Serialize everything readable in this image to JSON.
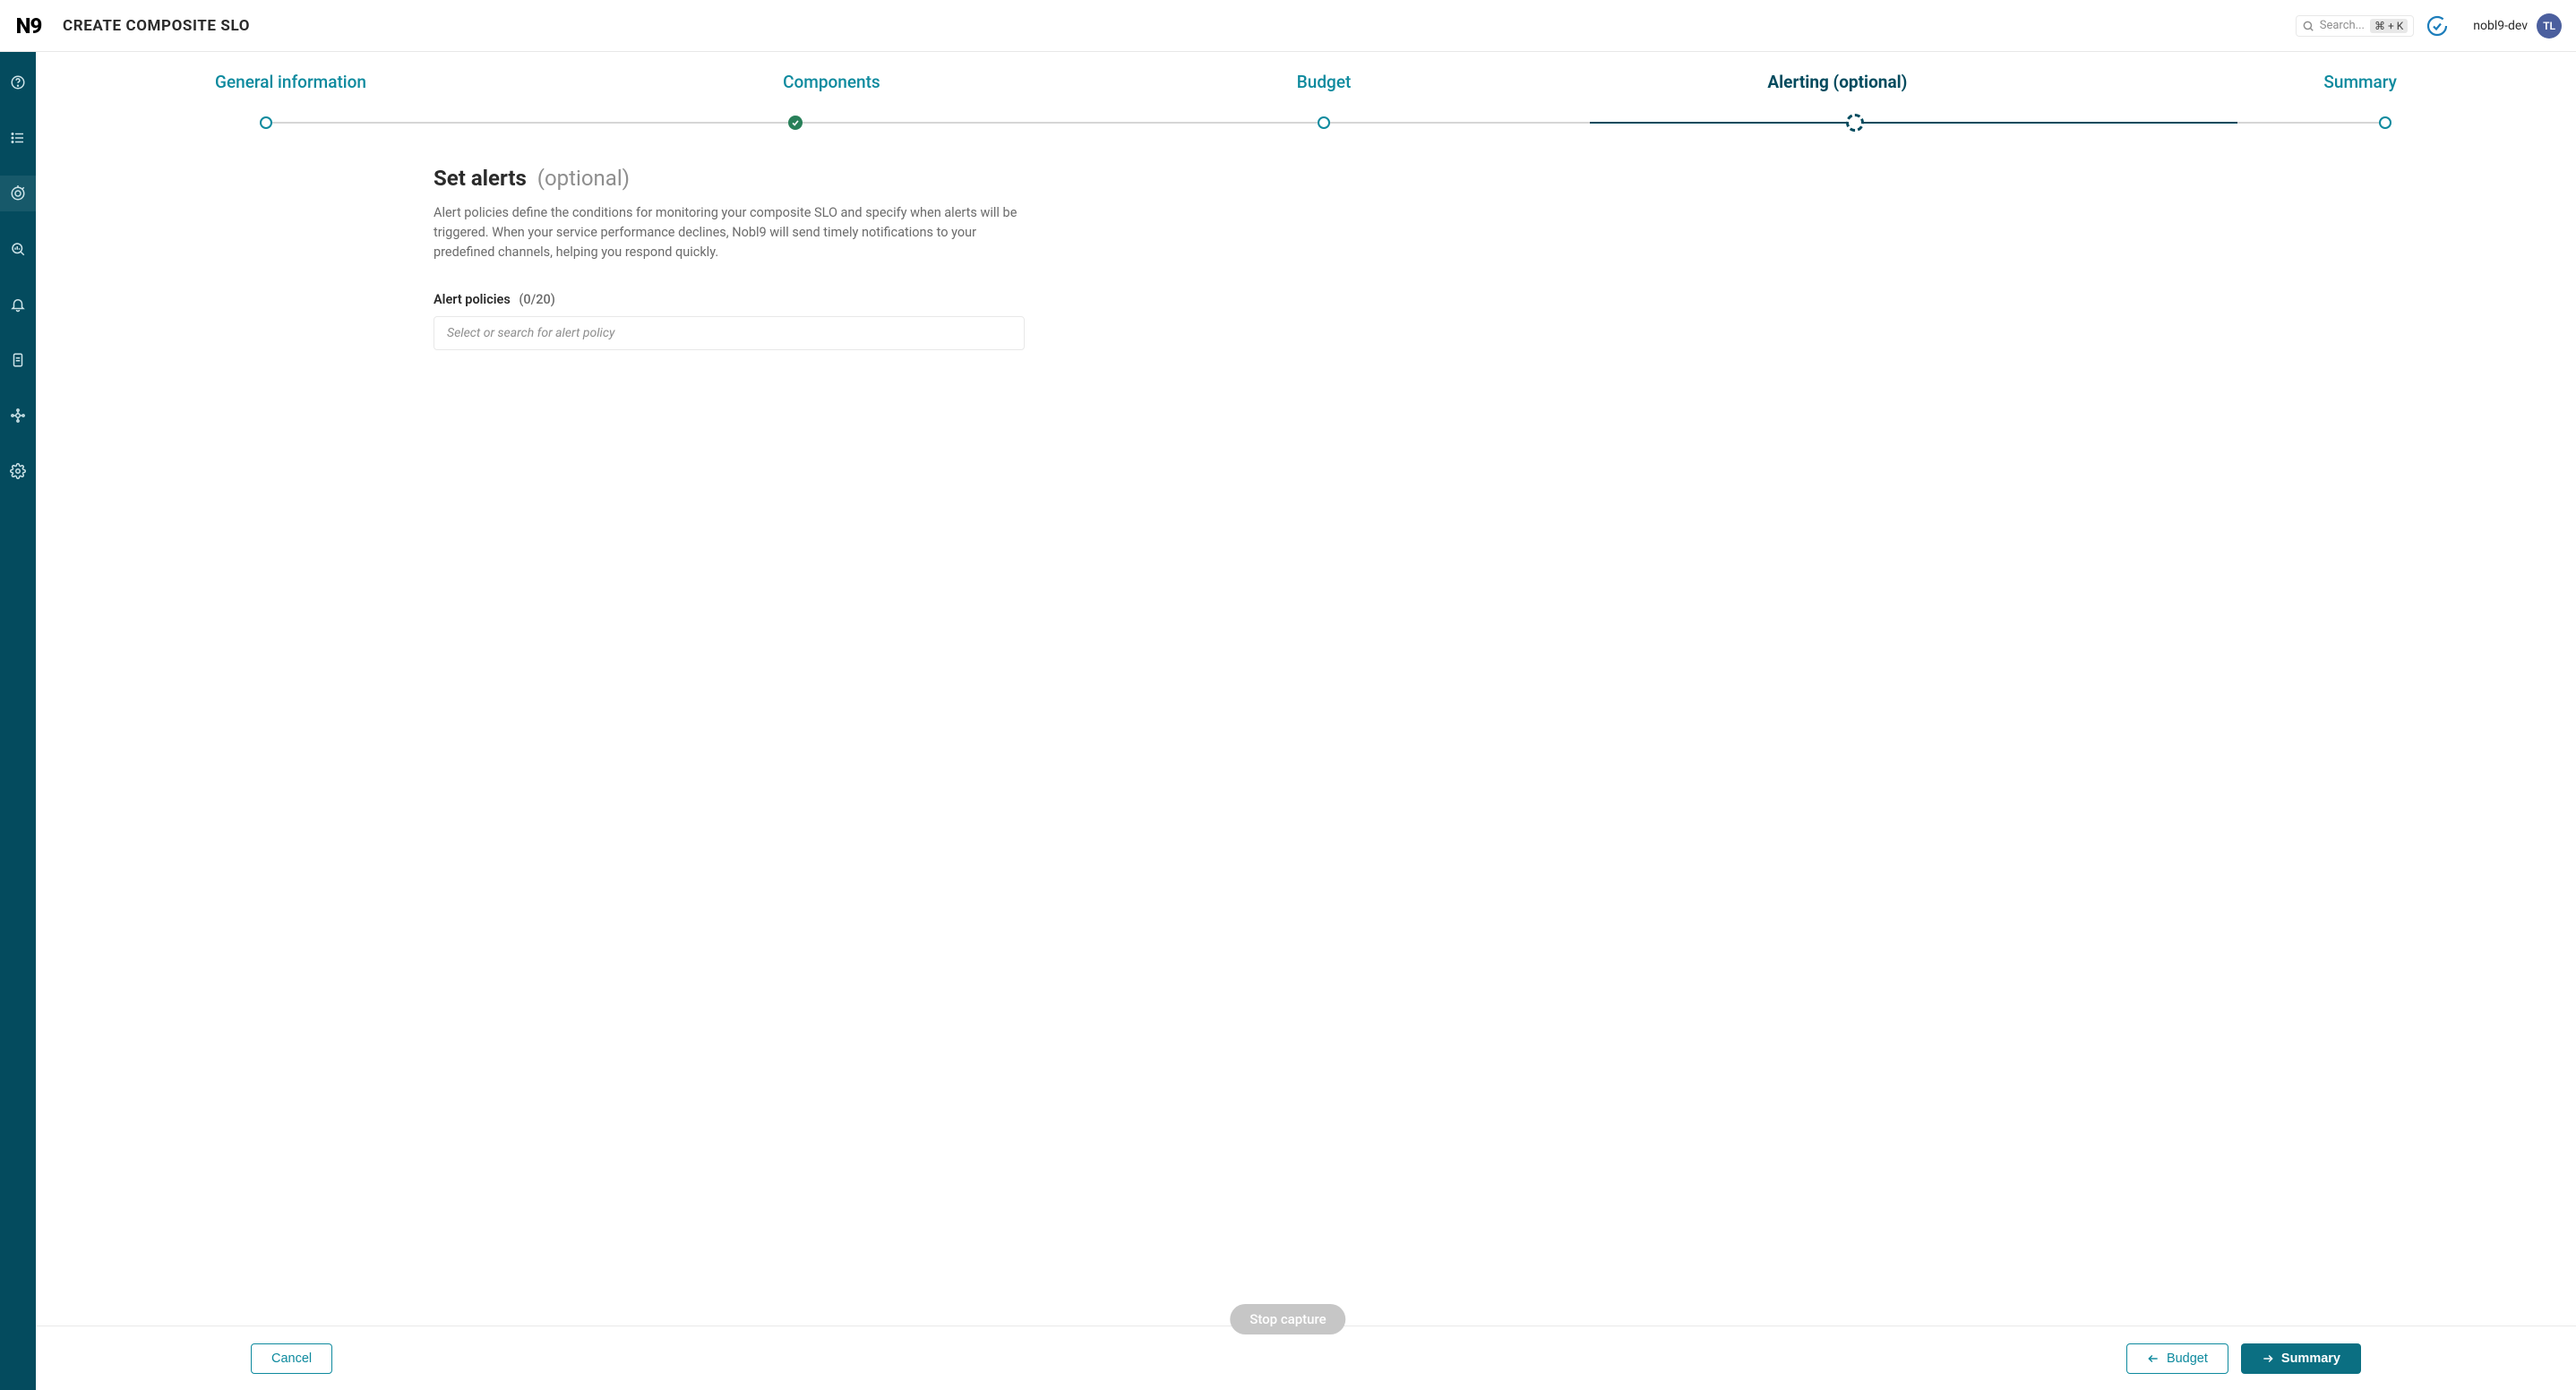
{
  "header": {
    "logo": "N9",
    "page_title": "CREATE COMPOSITE SLO",
    "search_placeholder": "Search...",
    "search_kbd": "⌘ + K",
    "user_org": "nobl9-dev",
    "user_initials": "TL"
  },
  "sidebar": {
    "items": [
      {
        "name": "help-icon"
      },
      {
        "name": "list-icon"
      },
      {
        "name": "target-icon",
        "active": true
      },
      {
        "name": "analytics-icon"
      },
      {
        "name": "bell-icon"
      },
      {
        "name": "clipboard-icon"
      },
      {
        "name": "integrations-icon"
      },
      {
        "name": "settings-icon"
      }
    ]
  },
  "stepper": {
    "steps": [
      {
        "label": "General information",
        "state": "open"
      },
      {
        "label": "Components",
        "state": "done"
      },
      {
        "label": "Budget",
        "state": "open"
      },
      {
        "label": "Alerting (optional)",
        "state": "current"
      },
      {
        "label": "Summary",
        "state": "open"
      }
    ]
  },
  "content": {
    "title": "Set alerts",
    "title_suffix": "(optional)",
    "description": "Alert policies define the conditions for monitoring your composite SLO and specify when alerts will be triggered. When your service performance declines, Nobl9 will send timely notifications to your predefined channels, helping you respond quickly.",
    "field_label": "Alert policies",
    "field_count": "(0/20)",
    "select_placeholder": "Select or search for alert policy"
  },
  "footer": {
    "cancel": "Cancel",
    "back": "Budget",
    "next": "Summary"
  },
  "overlay": {
    "stop_capture": "Stop capture"
  }
}
